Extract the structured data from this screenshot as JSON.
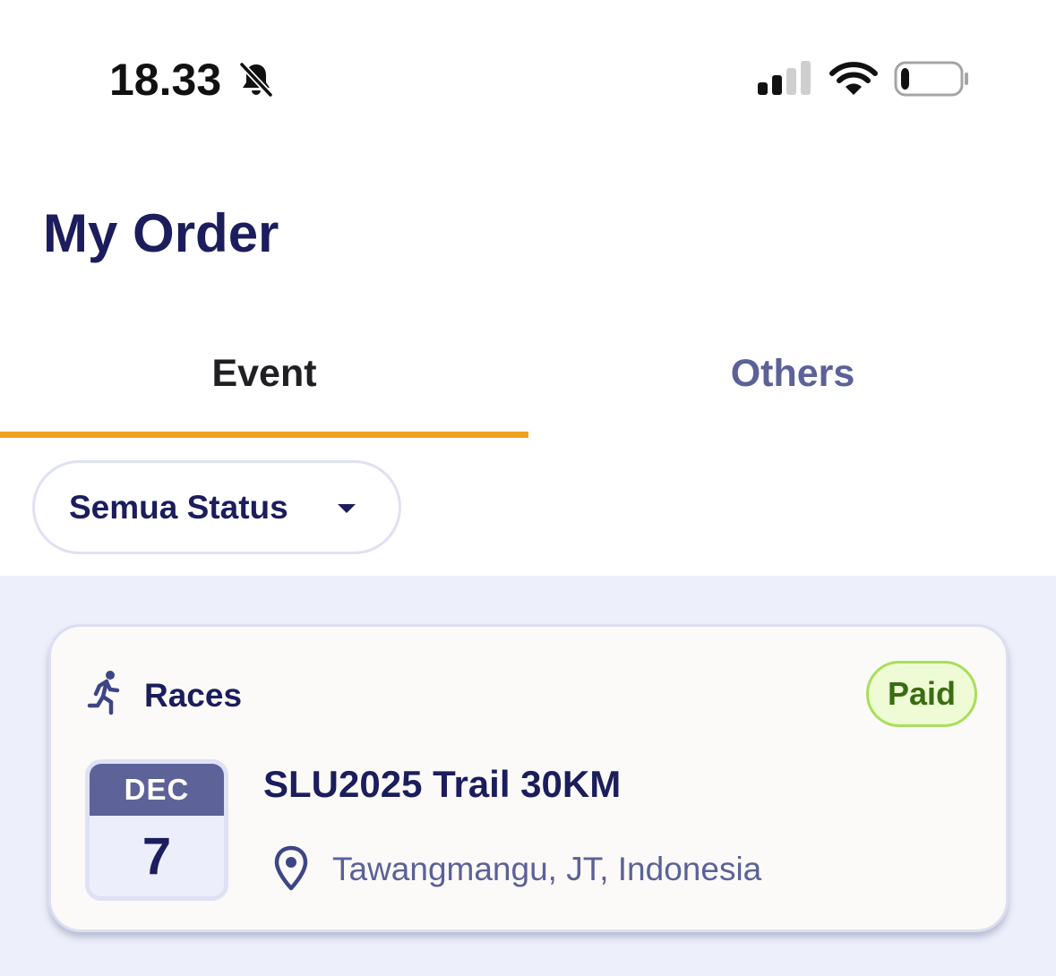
{
  "status_bar": {
    "time": "18.33",
    "icons": [
      "bell-muted-icon",
      "cellular-signal-icon",
      "wifi-icon",
      "battery-low-icon"
    ],
    "battery_level": 0.15
  },
  "header": {
    "title": "My Order"
  },
  "tabs": [
    {
      "label": "Event",
      "active": true
    },
    {
      "label": "Others",
      "active": false
    }
  ],
  "filter": {
    "selected": "Semua Status",
    "icon": "caret-down-icon"
  },
  "orders": [
    {
      "category": "Races",
      "category_icon": "runner-icon",
      "status": "Paid",
      "date": {
        "month": "DEC",
        "day": "7"
      },
      "event_name": "SLU2025 Trail 30KM",
      "location_icon": "location-pin-icon",
      "location": "Tawangmangu, JT, Indonesia"
    }
  ],
  "colors": {
    "primary": "#1b1d5c",
    "secondary": "#5c6197",
    "accent": "#eea31e",
    "paid_text": "#3a6d12",
    "paid_bg": "#effbd4",
    "paid_border": "#a8df5a",
    "list_bg": "#edf0fb"
  }
}
